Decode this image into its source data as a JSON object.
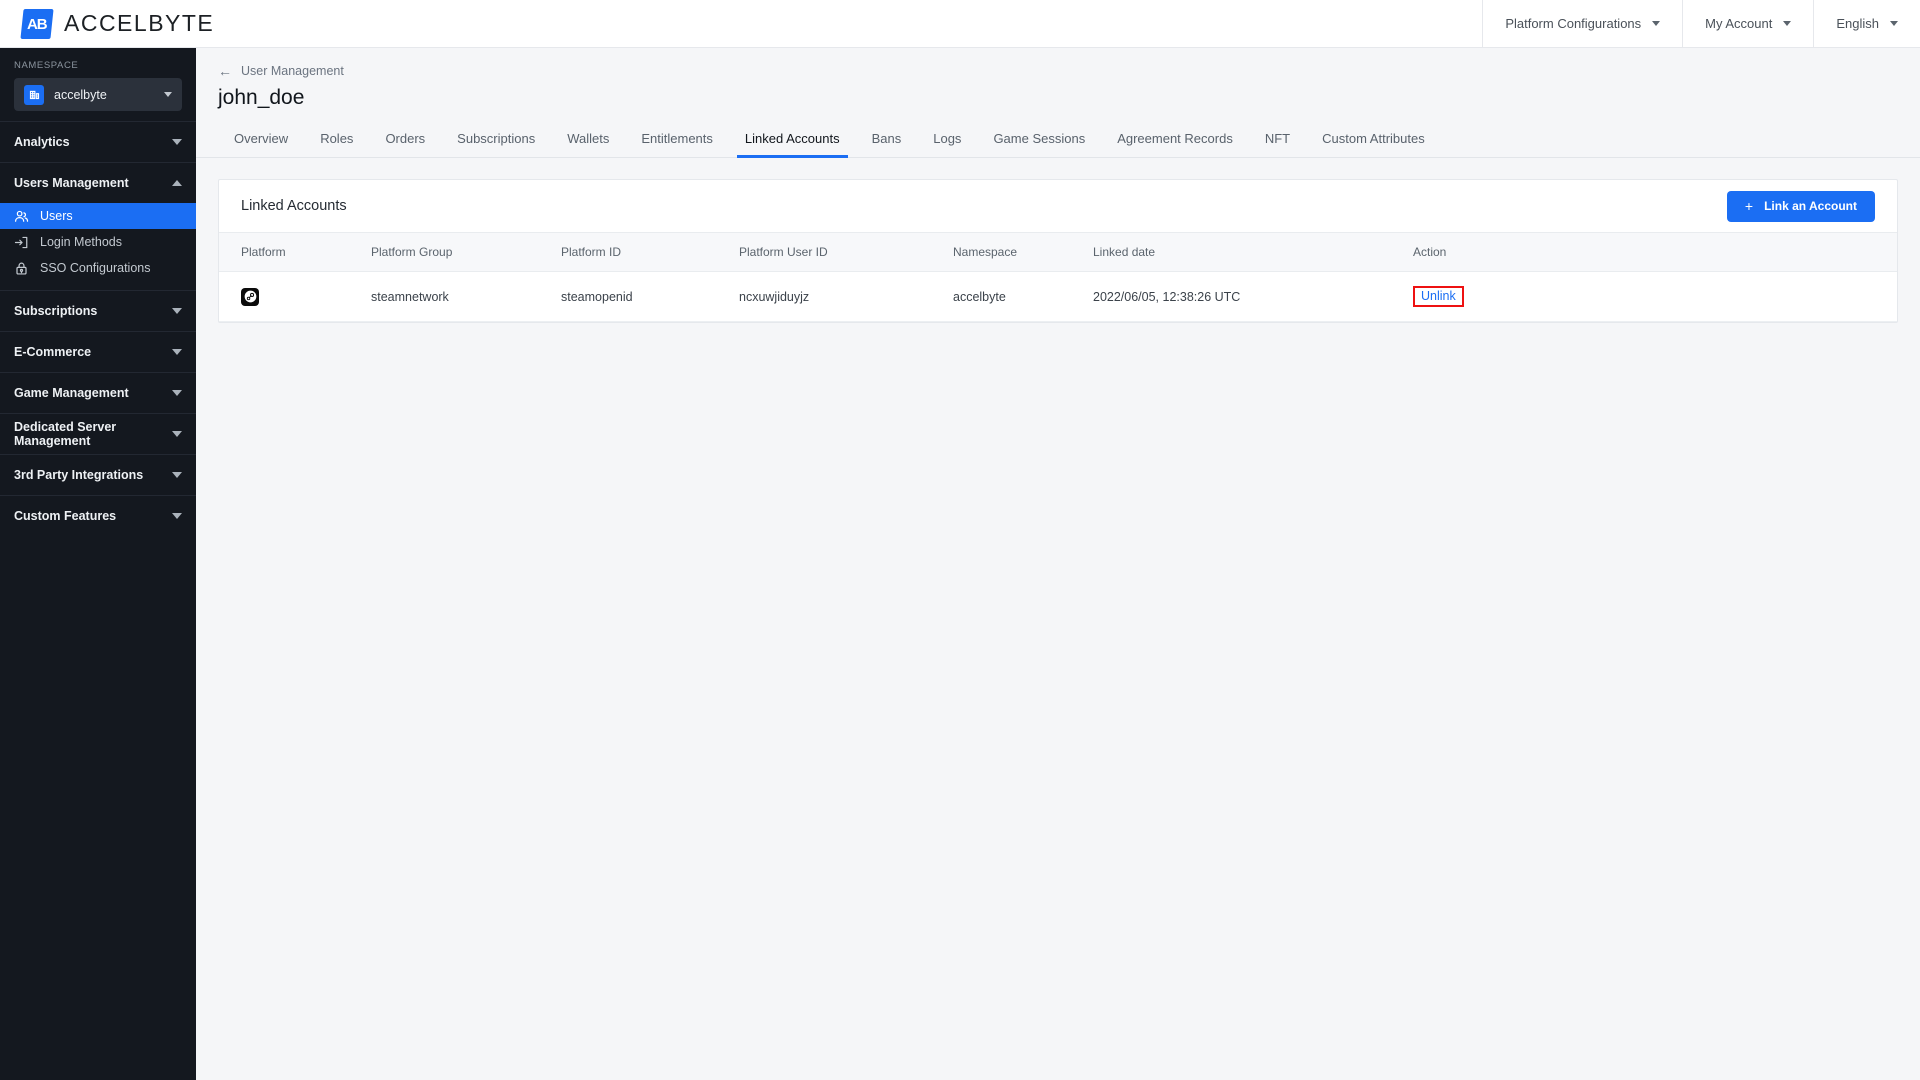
{
  "topbar": {
    "brand_mark": "AB",
    "brand_name": "ACCELBYTE",
    "menus": [
      {
        "label": "Platform Configurations",
        "icon": "chevron-down-icon"
      },
      {
        "label": "My Account",
        "icon": "chevron-down-icon"
      },
      {
        "label": "English",
        "icon": "chevron-down-icon"
      }
    ]
  },
  "sidebar": {
    "namespace_label": "NAMESPACE",
    "namespace_value": "accelbyte",
    "namespace_icon": "building-icon",
    "groups": [
      {
        "label": "Analytics",
        "expanded": false,
        "items": []
      },
      {
        "label": "Users Management",
        "expanded": true,
        "items": [
          {
            "label": "Users",
            "icon": "users-icon",
            "active": true
          },
          {
            "label": "Login Methods",
            "icon": "login-icon",
            "active": false
          },
          {
            "label": "SSO Configurations",
            "icon": "lock-icon",
            "active": false
          }
        ]
      },
      {
        "label": "Subscriptions",
        "expanded": false,
        "items": []
      },
      {
        "label": "E-Commerce",
        "expanded": false,
        "items": []
      },
      {
        "label": "Game Management",
        "expanded": false,
        "items": []
      },
      {
        "label": "Dedicated Server Management",
        "expanded": false,
        "items": []
      },
      {
        "label": "3rd Party Integrations",
        "expanded": false,
        "items": []
      },
      {
        "label": "Custom Features",
        "expanded": false,
        "items": []
      }
    ]
  },
  "page": {
    "breadcrumb": "User Management",
    "breadcrumb_icon": "back-arrow-icon",
    "title": "john_doe",
    "tabs": [
      {
        "label": "Overview",
        "active": false
      },
      {
        "label": "Roles",
        "active": false
      },
      {
        "label": "Orders",
        "active": false
      },
      {
        "label": "Subscriptions",
        "active": false
      },
      {
        "label": "Wallets",
        "active": false
      },
      {
        "label": "Entitlements",
        "active": false
      },
      {
        "label": "Linked Accounts",
        "active": true
      },
      {
        "label": "Bans",
        "active": false
      },
      {
        "label": "Logs",
        "active": false
      },
      {
        "label": "Game Sessions",
        "active": false
      },
      {
        "label": "Agreement Records",
        "active": false
      },
      {
        "label": "NFT",
        "active": false
      },
      {
        "label": "Custom Attributes",
        "active": false
      }
    ]
  },
  "card": {
    "title": "Linked Accounts",
    "action_button": {
      "label": "Link an Account",
      "plus": "+",
      "color": "#1b6ef3"
    },
    "columns": [
      "Platform",
      "Platform Group",
      "Platform ID",
      "Platform User ID",
      "Namespace",
      "Linked date",
      "Action"
    ],
    "rows": [
      {
        "platform_icon": "steam-icon",
        "platform_group": "steamnetwork",
        "platform_id": "steamopenid",
        "platform_user_id": "ncxuwjiduyjz",
        "namespace": "accelbyte",
        "linked_date": "2022/06/05, 12:38:26 UTC",
        "action": "Unlink"
      }
    ]
  },
  "highlight": {
    "color": "#ee1111",
    "target": "Unlink"
  }
}
